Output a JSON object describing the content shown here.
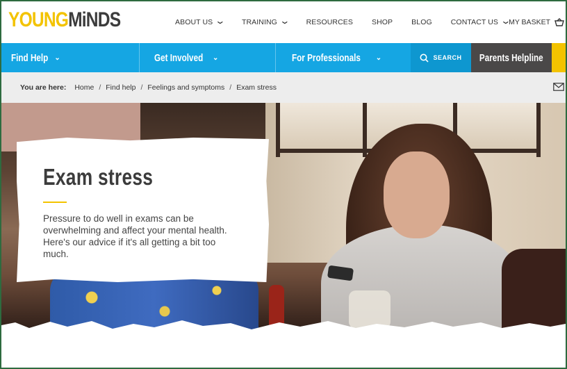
{
  "logo": {
    "part1": "YOUNG",
    "part2": "MiNDS"
  },
  "top_nav": [
    {
      "label": "ABOUT US",
      "has_dropdown": true
    },
    {
      "label": "TRAINING",
      "has_dropdown": true
    },
    {
      "label": "RESOURCES",
      "has_dropdown": false
    },
    {
      "label": "SHOP",
      "has_dropdown": false
    },
    {
      "label": "BLOG",
      "has_dropdown": false
    },
    {
      "label": "CONTACT US",
      "has_dropdown": true
    }
  ],
  "basket": {
    "label": "MY BASKET",
    "icon": "basket-icon"
  },
  "main_nav": {
    "find_help": "Find Help",
    "get_involved": "Get Involved",
    "for_professionals": "For Professionals",
    "search": "SEARCH",
    "parents_helpline": "Parents Helpline",
    "chevron": "⌄"
  },
  "breadcrumb": {
    "prefix": "You are here:",
    "items": [
      "Home",
      "Find help",
      "Feelings and symptoms",
      "Exam stress"
    ],
    "separator": "/"
  },
  "hero": {
    "title": "Exam stress",
    "intro": "Pressure to do well in exams can be overwhelming and affect your mental health. Here's our advice if it's all getting a bit too much."
  },
  "colors": {
    "brand_yellow": "#f3c300",
    "nav_blue": "#15a6e3",
    "search_blue": "#0e97d0",
    "helpline_grey": "#4a4848",
    "breadcrumb_bg": "#ededed"
  }
}
